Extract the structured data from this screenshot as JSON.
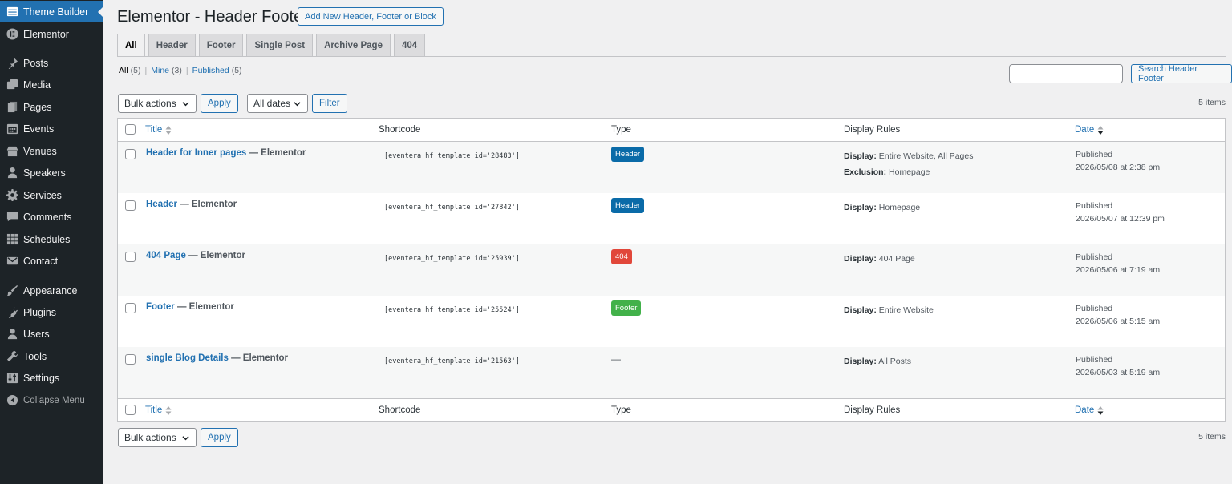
{
  "sidebar": {
    "items": [
      {
        "label": "Theme Builder",
        "icon": "theme-builder-icon",
        "active": true
      },
      {
        "label": "Elementor",
        "icon": "elementor-icon"
      },
      {
        "label": "Posts",
        "icon": "pushpin-icon"
      },
      {
        "label": "Media",
        "icon": "media-icon"
      },
      {
        "label": "Pages",
        "icon": "pages-icon"
      },
      {
        "label": "Events",
        "icon": "calendar-icon"
      },
      {
        "label": "Venues",
        "icon": "store-icon"
      },
      {
        "label": "Speakers",
        "icon": "person-icon"
      },
      {
        "label": "Services",
        "icon": "gear-icon"
      },
      {
        "label": "Comments",
        "icon": "comment-icon"
      },
      {
        "label": "Schedules",
        "icon": "grid-icon"
      },
      {
        "label": "Contact",
        "icon": "mail-icon"
      },
      {
        "label": "Appearance",
        "icon": "brush-icon"
      },
      {
        "label": "Plugins",
        "icon": "plugin-icon"
      },
      {
        "label": "Users",
        "icon": "users-icon"
      },
      {
        "label": "Tools",
        "icon": "wrench-icon"
      },
      {
        "label": "Settings",
        "icon": "settings-icon"
      }
    ],
    "collapse_label": "Collapse Menu"
  },
  "header": {
    "title": "Elementor - Header Footer",
    "add_new_label": "Add New Header, Footer or Block"
  },
  "tabs": [
    {
      "label": "All",
      "active": true
    },
    {
      "label": "Header"
    },
    {
      "label": "Footer"
    },
    {
      "label": "Single Post"
    },
    {
      "label": "Archive Page"
    },
    {
      "label": "404"
    }
  ],
  "filters_views": {
    "all": "All",
    "all_count": "(5)",
    "mine": "Mine",
    "mine_count": "(3)",
    "published": "Published",
    "published_count": "(5)",
    "sep": "|"
  },
  "search": {
    "value": "",
    "button_label": "Search Header Footer"
  },
  "bulk_top": {
    "select_value": "Bulk actions",
    "apply_label": "Apply"
  },
  "date_filter": {
    "select_value": "All dates",
    "filter_label": "Filter"
  },
  "bulk_bottom": {
    "select_value": "Bulk actions",
    "apply_label": "Apply"
  },
  "items_count": "5 items",
  "table": {
    "columns": {
      "title": "Title",
      "shortcode": "Shortcode",
      "type": "Type",
      "rules": "Display Rules",
      "date": "Date"
    },
    "rows": [
      {
        "title": "Header for Inner pages",
        "suffix": " — Elementor",
        "shortcode": "[eventera_hf_template id='28483']",
        "type": "Header",
        "type_color": "#0a6ba8",
        "display_label": "Display:",
        "display_value": " Entire Website, All Pages",
        "exclusion_label": "Exclusion:",
        "exclusion_value": " Homepage",
        "status": "Published",
        "date": "2026/05/08 at 2:38 pm"
      },
      {
        "title": "Header",
        "suffix": " — Elementor",
        "shortcode": "[eventera_hf_template id='27842']",
        "type": "Header",
        "type_color": "#0a6ba8",
        "display_label": "Display:",
        "display_value": " Homepage",
        "status": "Published",
        "date": "2026/05/07 at 12:39 pm"
      },
      {
        "title": "404 Page",
        "suffix": " — Elementor",
        "shortcode": "[eventera_hf_template id='25939']",
        "type": "404",
        "type_color": "#e1473a",
        "display_label": "Display:",
        "display_value": " 404 Page",
        "status": "Published",
        "date": "2026/05/06 at 7:19 am"
      },
      {
        "title": "Footer",
        "suffix": " — Elementor",
        "shortcode": "[eventera_hf_template id='25524']",
        "type": "Footer",
        "type_color": "#42b14a",
        "display_label": "Display:",
        "display_value": " Entire Website",
        "status": "Published",
        "date": "2026/05/06 at 5:15 am"
      },
      {
        "title": "single Blog Details",
        "suffix": " — Elementor",
        "shortcode": "[eventera_hf_template id='21563']",
        "type_dash": "—",
        "display_label": "Display:",
        "display_value": " All Posts",
        "status": "Published",
        "date": "2026/05/03 at 5:19 am"
      }
    ]
  },
  "colors": {
    "sidebar_bg": "#1d2327",
    "accent": "#2271b1",
    "header_badge": "#0a6ba8",
    "footer_badge": "#42b14a",
    "error_badge": "#e1473a"
  }
}
